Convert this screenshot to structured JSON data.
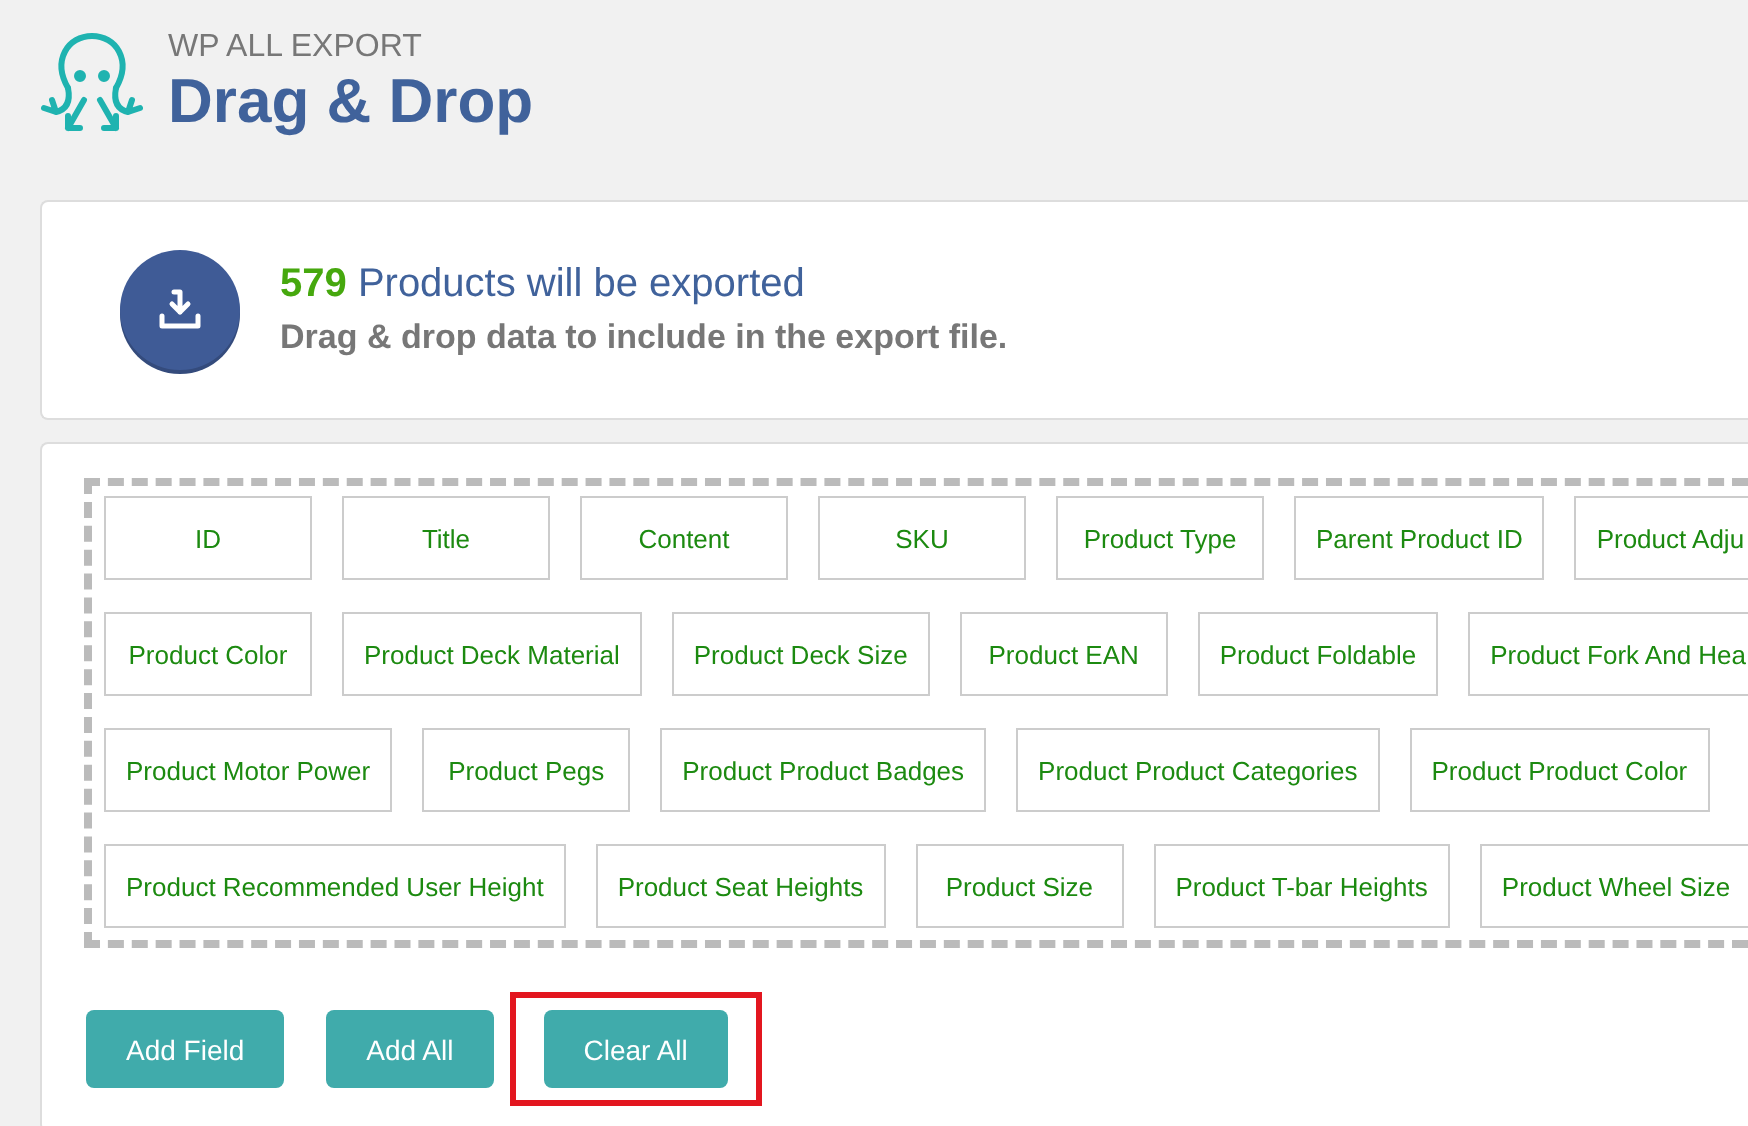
{
  "header": {
    "brand": "WP ALL EXPORT",
    "title": "Drag & Drop"
  },
  "summary": {
    "count": "579",
    "headline": "Products will be exported",
    "subtitle": "Drag & drop data to include in the export file."
  },
  "fields": [
    [
      {
        "label": "ID",
        "cut": false
      },
      {
        "label": "Title",
        "cut": false
      },
      {
        "label": "Content",
        "cut": false
      },
      {
        "label": "SKU",
        "cut": false
      },
      {
        "label": "Product Type",
        "cut": false
      },
      {
        "label": "Parent Product ID",
        "cut": false
      },
      {
        "label": "Product Adju",
        "cut": true
      }
    ],
    [
      {
        "label": "Product Color",
        "cut": false
      },
      {
        "label": "Product Deck Material",
        "cut": false
      },
      {
        "label": "Product Deck Size",
        "cut": false
      },
      {
        "label": "Product EAN",
        "cut": false
      },
      {
        "label": "Product Foldable",
        "cut": false
      },
      {
        "label": "Product Fork And Hea",
        "cut": true
      }
    ],
    [
      {
        "label": "Product Motor Power",
        "cut": false
      },
      {
        "label": "Product Pegs",
        "cut": false
      },
      {
        "label": "Product Product Badges",
        "cut": false
      },
      {
        "label": "Product Product Categories",
        "cut": false
      },
      {
        "label": "Product Product Color",
        "cut": false
      }
    ],
    [
      {
        "label": "Product Recommended User Height",
        "cut": false
      },
      {
        "label": "Product Seat Heights",
        "cut": false
      },
      {
        "label": "Product Size",
        "cut": false
      },
      {
        "label": "Product T-bar Heights",
        "cut": false
      },
      {
        "label": "Product Wheel Size",
        "cut": false
      }
    ]
  ],
  "buttons": [
    {
      "label": "Add Field",
      "highlighted": false
    },
    {
      "label": "Add All",
      "highlighted": false
    },
    {
      "label": "Clear All",
      "highlighted": true
    }
  ]
}
